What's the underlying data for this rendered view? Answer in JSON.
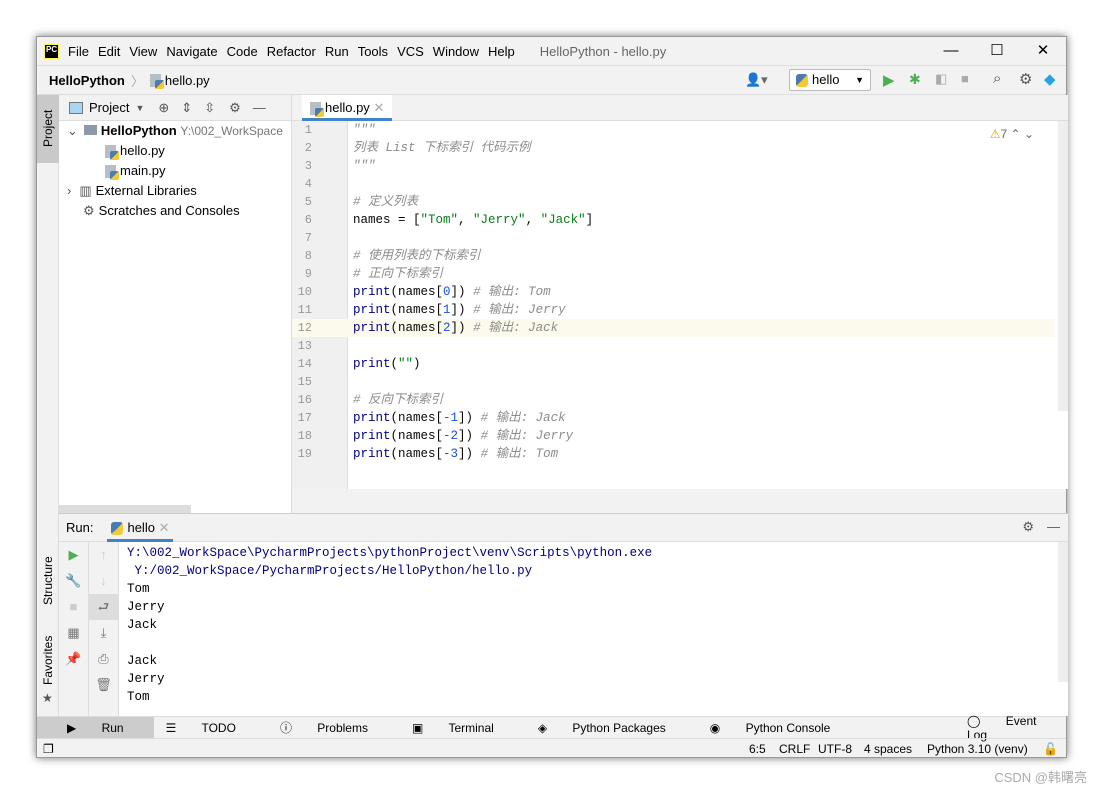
{
  "window": {
    "title": "HelloPython - hello.py",
    "logo": "PC"
  },
  "menu": [
    "File",
    "Edit",
    "View",
    "Navigate",
    "Code",
    "Refactor",
    "Run",
    "Tools",
    "VCS",
    "Window",
    "Help"
  ],
  "breadcrumb": {
    "project": "HelloPython",
    "file": "hello.py"
  },
  "toolbar": {
    "run_config": "hello"
  },
  "sidebar": {
    "project_tab": "Project",
    "structure_tab": "Structure",
    "favorites_tab": "Favorites"
  },
  "project": {
    "header": "Project",
    "root": "HelloPython",
    "root_path": "Y:\\002_WorkSpace",
    "files": [
      "hello.py",
      "main.py"
    ],
    "external": "External Libraries",
    "scratches": "Scratches and Consoles"
  },
  "editor": {
    "tab": "hello.py",
    "warnings": "7",
    "lines": [
      [
        [
          "\"\"\"",
          "doc"
        ]
      ],
      [
        [
          "列表 List 下标索引 代码示例",
          "doc"
        ]
      ],
      [
        [
          "\"\"\"",
          "doc"
        ]
      ],
      [],
      [
        [
          "# 定义列表",
          "com"
        ]
      ],
      [
        [
          "names = [",
          "def"
        ],
        [
          "\"Tom\"",
          "str"
        ],
        [
          ", ",
          "def"
        ],
        [
          "\"Jerry\"",
          "str"
        ],
        [
          ", ",
          "def"
        ],
        [
          "\"Jack\"",
          "str"
        ],
        [
          "]",
          "def"
        ]
      ],
      [],
      [
        [
          "# 使用列表的下标索引",
          "com"
        ]
      ],
      [
        [
          "# 正向下标索引",
          "com"
        ]
      ],
      [
        [
          "print",
          "fn"
        ],
        [
          "(names[",
          "def"
        ],
        [
          "0",
          "num"
        ],
        [
          "]) ",
          "def"
        ],
        [
          "# 输出: Tom",
          "com"
        ]
      ],
      [
        [
          "print",
          "fn"
        ],
        [
          "(names[",
          "def"
        ],
        [
          "1",
          "num"
        ],
        [
          "]) ",
          "def"
        ],
        [
          "# 输出: Jerry",
          "com"
        ]
      ],
      [
        [
          "print",
          "fn"
        ],
        [
          "(names[",
          "def"
        ],
        [
          "2",
          "num"
        ],
        [
          "]) ",
          "def"
        ],
        [
          "# 输出: Jack",
          "com"
        ]
      ],
      [],
      [
        [
          "print",
          "fn"
        ],
        [
          "(",
          "def"
        ],
        [
          "\"\"",
          "str"
        ],
        [
          ")",
          "def"
        ]
      ],
      [],
      [
        [
          "# 反向下标索引",
          "com"
        ]
      ],
      [
        [
          "print",
          "fn"
        ],
        [
          "(names[",
          "def"
        ],
        [
          "-1",
          "num"
        ],
        [
          "]) ",
          "def"
        ],
        [
          "# 输出: Jack",
          "com"
        ]
      ],
      [
        [
          "print",
          "fn"
        ],
        [
          "(names[",
          "def"
        ],
        [
          "-2",
          "num"
        ],
        [
          "]) ",
          "def"
        ],
        [
          "# 输出: Jerry",
          "com"
        ]
      ],
      [
        [
          "print",
          "fn"
        ],
        [
          "(names[",
          "def"
        ],
        [
          "-3",
          "num"
        ],
        [
          "]) ",
          "def"
        ],
        [
          "# 输出: Tom",
          "com"
        ]
      ]
    ],
    "current_line": 12
  },
  "run": {
    "label": "Run:",
    "tab": "hello",
    "output": [
      "Y:\\002_WorkSpace\\PycharmProjects\\pythonProject\\venv\\Scripts\\python.exe",
      " Y:/002_WorkSpace/PycharmProjects/HelloPython/hello.py",
      "Tom",
      "Jerry",
      "Jack",
      "",
      "Jack",
      "Jerry",
      "Tom"
    ]
  },
  "bottom_tabs": [
    "Run",
    "TODO",
    "Problems",
    "Terminal",
    "Python Packages",
    "Python Console"
  ],
  "event_log": "Event Log",
  "status": {
    "position": "6:5",
    "line_sep": "CRLF",
    "encoding": "UTF-8",
    "indent": "4 spaces",
    "interpreter": "Python 3.10 (venv)"
  },
  "watermark": "CSDN @韩曙亮",
  "colors": {
    "accent": "#4083c9",
    "string": "#067d17",
    "number": "#1750eb",
    "keyword_fn": "#000080",
    "comment": "#8c8c8c"
  }
}
